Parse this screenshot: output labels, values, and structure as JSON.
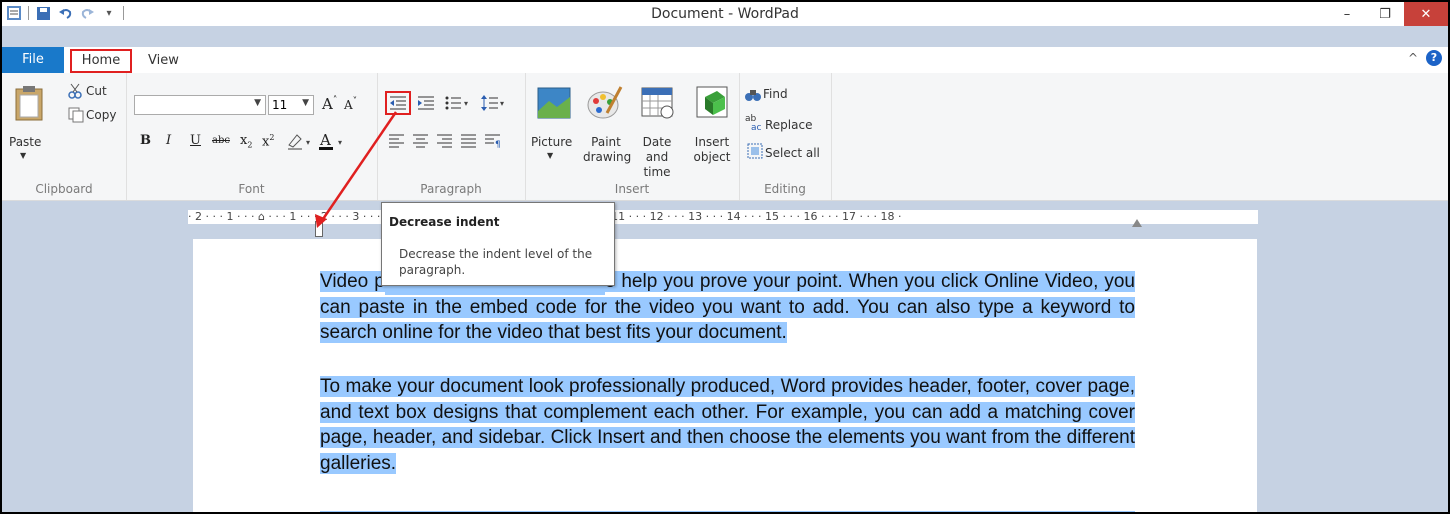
{
  "window": {
    "title": "Document - WordPad"
  },
  "tabs": {
    "file": "File",
    "home": "Home",
    "view": "View"
  },
  "clipboard": {
    "paste": "Paste",
    "cut": "Cut",
    "copy": "Copy",
    "label": "Clipboard"
  },
  "font": {
    "name_value": "",
    "size_value": "11",
    "label": "Font",
    "bold": "B",
    "italic": "I",
    "underline": "U",
    "strike": "abc"
  },
  "paragraph": {
    "label": "Paragraph"
  },
  "insert": {
    "picture": "Picture",
    "paint": "Paint drawing",
    "datetime": "Date and time",
    "object": "Insert object",
    "label": "Insert"
  },
  "editing": {
    "find": "Find",
    "replace": "Replace",
    "select_all": "Select all",
    "label": "Editing"
  },
  "ruler": {
    "text": "· 2 · · · 1 · · · ⌂ · · · 1 · · · 2 · · · 3 · · · 4 · · · 5 · · · 6 · · · 7 · · · 8 · · · 9 · · · 10 · · · 11 · · · 12 · · · 13 · · · 14 · · · 15 · · · 16 · · · 17 · · · 18 ·"
  },
  "tooltip": {
    "title": "Decrease indent",
    "body": "Decrease the indent level of the paragraph."
  },
  "document": {
    "p1_visible_start": "Video p",
    "p1_rest": "o help you prove your point. When you click Online Video, you can paste in the embed code for the video you want to add. You can also type a keyword to search online for the video that best fits your document.",
    "p2": "To make your document look professionally produced, Word provides header, footer, cover page, and text box designs that complement each other. For example, you can add a matching cover page, header, and sidebar. Click Insert and then choose the elements you want from the different galleries."
  },
  "colors": {
    "accent": "#1979ca",
    "selection": "#99c9ff",
    "annotation": "#e02020"
  }
}
